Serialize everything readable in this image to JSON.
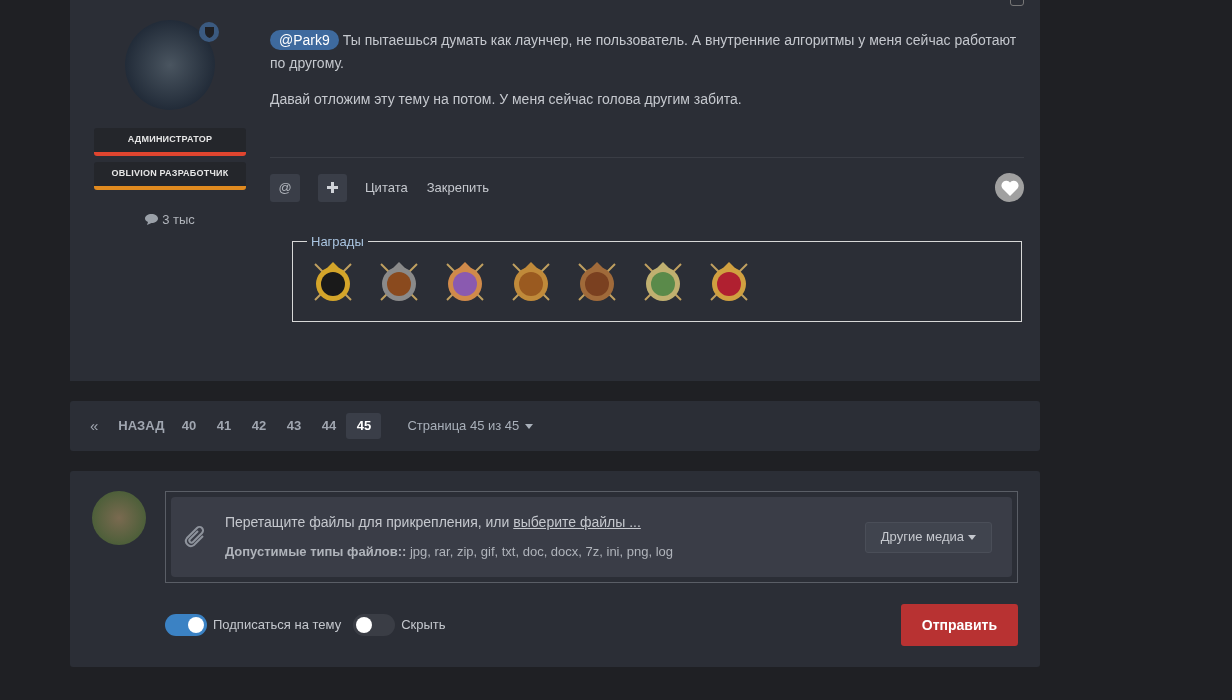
{
  "post": {
    "select_checkbox": {
      "checked": false
    },
    "author": {
      "badges": [
        {
          "label": "АДМИНИСТРАТОР",
          "color": "#e0452f"
        },
        {
          "label": "OBLIVION РАЗРАБОТЧИК",
          "color": "#e08a1f"
        }
      ],
      "posts": "3 тыс"
    },
    "mention": "@Park9",
    "paragraphs": [
      "Ты пытаешься думать как лаунчер, не пользователь. А внутренние алгоритмы у меня сейчас работают по другому.",
      "Давай отложим эту тему на потом. У меня сейчас голова другим забита."
    ],
    "actions": {
      "mention_button": "@",
      "quote": "Цитата",
      "pin": "Закрепить"
    },
    "awards": {
      "legend": "Награды"
    }
  },
  "pagination": {
    "prev_arrow": "«",
    "prev": "НАЗАД",
    "pages": [
      {
        "label": "40",
        "selected": false
      },
      {
        "label": "41",
        "selected": false
      },
      {
        "label": "42",
        "selected": false
      },
      {
        "label": "43",
        "selected": false
      },
      {
        "label": "44",
        "selected": false
      },
      {
        "label": "45",
        "selected": true
      }
    ],
    "page_of": "Страница 45 из 45"
  },
  "reply": {
    "upload_text": "Перетащите файлы для прикрепления, или ",
    "upload_link": "выберите файлы ...",
    "allowed_label": "Допустимые типы файлов::",
    "allowed_types": "jpg, rar, zip, gif, txt, doc, docx, 7z, ini, png, log",
    "other_media": "Другие медиа",
    "toggles": [
      {
        "label": "Подписаться на тему",
        "on": true
      },
      {
        "label": "Скрыть",
        "on": false
      }
    ],
    "submit": "Отправить"
  }
}
